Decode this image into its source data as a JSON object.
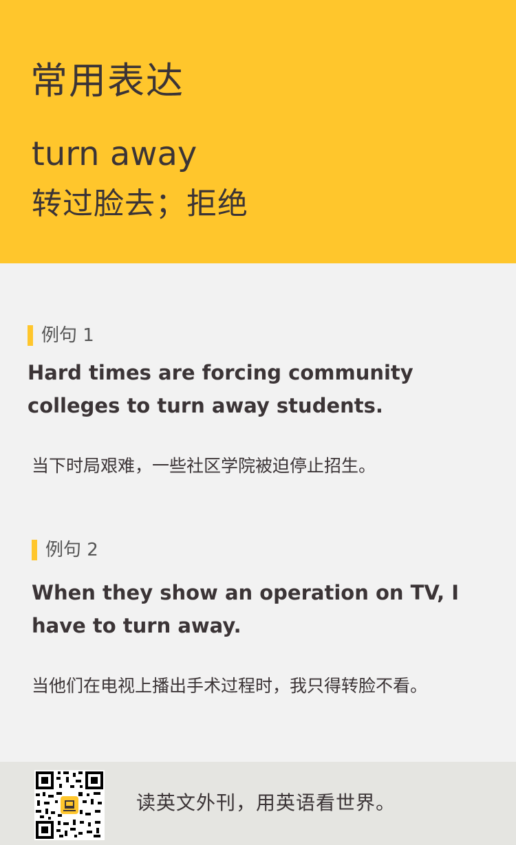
{
  "header": {
    "title": "常用表达",
    "phrase_en": "turn away",
    "phrase_cn": "转过脸去；拒绝",
    "background_color": "#ffc62c"
  },
  "examples": [
    {
      "label": "例句 1",
      "en": "Hard times are forcing community colleges to turn away students.",
      "cn": "当下时局艰难，一些社区学院被迫停止招生。"
    },
    {
      "label": "例句 2",
      "en": "When they show an operation on TV, I have to turn away.",
      "cn": "当他们在电视上播出手术过程时，我只得转脸不看。"
    }
  ],
  "footer": {
    "qr_icon": "qr-code-icon",
    "slogan": "读英文外刊，用英语看世界。"
  }
}
